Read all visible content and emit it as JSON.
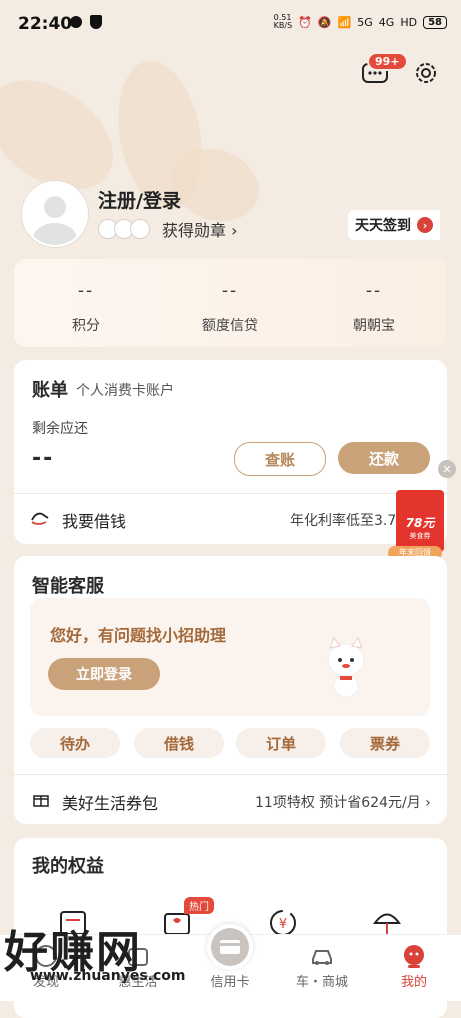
{
  "status_bar": {
    "time": "22:40",
    "net_speed": "0.51\nKB/S",
    "signal1": "5G",
    "signal2": "4G",
    "hd": "HD",
    "battery": "58"
  },
  "header": {
    "message_badge": "99+"
  },
  "profile": {
    "login_title": "注册/登录",
    "medal_text": "获得勋章 ›",
    "checkin_label": "天天签到"
  },
  "stats": [
    {
      "value": "--",
      "label": "积分"
    },
    {
      "value": "--",
      "label": "额度信贷"
    },
    {
      "value": "--",
      "label": "朝朝宝"
    }
  ],
  "bill": {
    "title": "账单",
    "subtitle": "个人消费卡账户",
    "remaining_label": "剩余应还",
    "remaining_value": "--",
    "check_button": "查账",
    "repay_button": "还款",
    "borrow_label": "我要借钱",
    "borrow_rate": "年化利率低至3.72"
  },
  "promo": {
    "amount": "78元",
    "coupon": "美食券",
    "tag": "年末回馈"
  },
  "service": {
    "title": "智能客服",
    "banner_text": "您好，有问题找小招助理",
    "banner_button": "立即登录",
    "pills": [
      "待办",
      "借钱",
      "订单",
      "票券"
    ],
    "gift_label": "美好生活券包",
    "gift_info": "11项特权 预计省624元/月 ›"
  },
  "rights": {
    "title": "我的权益",
    "hot_tag": "热门"
  },
  "nav": [
    {
      "label": "发现"
    },
    {
      "label": "惠生活"
    },
    {
      "label": "信用卡"
    },
    {
      "label": "车・商城"
    },
    {
      "label": "我的"
    }
  ],
  "watermark": {
    "big": "好赚网",
    "small": "www.zhuanyes.com"
  },
  "colors": {
    "accent": "#c9a27a",
    "red": "#d9423a",
    "background": "#f4ebe3"
  }
}
